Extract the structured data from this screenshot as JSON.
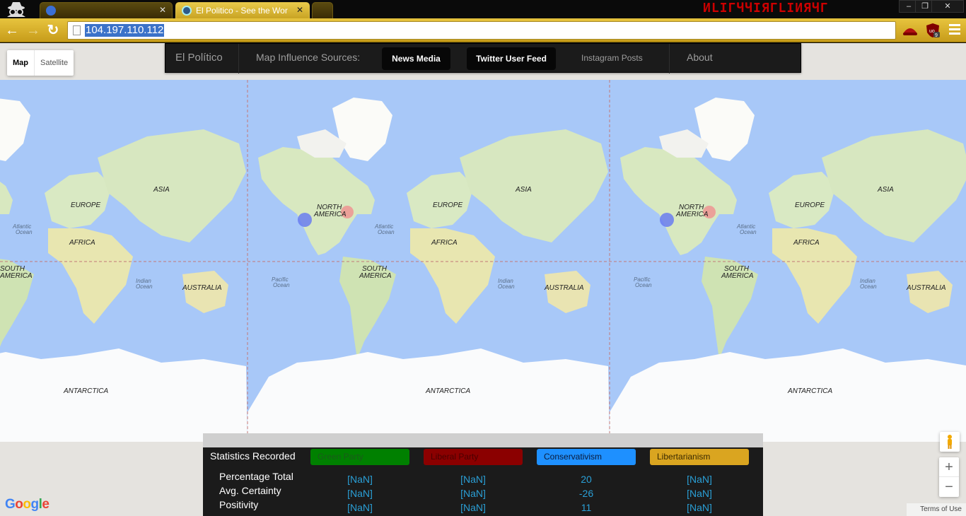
{
  "browser": {
    "tabs": [
      {
        "title": "",
        "active": false
      },
      {
        "title": "El Politico - See the World",
        "active": true
      },
      {
        "title": "",
        "active": false
      }
    ],
    "brand_text": "ИLIГЧЧIЯГLIИЯЧГ",
    "address": "104.197.110.112",
    "window_buttons": [
      "–",
      "❐",
      "✕"
    ]
  },
  "map_type": {
    "map_label": "Map",
    "satellite_label": "Satellite",
    "selected": "Map"
  },
  "navbar": {
    "brand": "El Político",
    "sources_label": "Map Influence Sources:",
    "news_media": "News Media",
    "twitter": "Twitter User Feed",
    "instagram": "Instagram Posts",
    "about": "About"
  },
  "map": {
    "labels": [
      {
        "text": "ASIA"
      },
      {
        "text": "EUROPE"
      },
      {
        "text": "AFRICA"
      },
      {
        "text": "AUSTRALIA"
      },
      {
        "text": "ANTARCTICA"
      },
      {
        "text": "NORTH"
      },
      {
        "text": "AMERICA"
      },
      {
        "text": "SOUTH"
      },
      {
        "text": "Atlantic"
      },
      {
        "text": "Ocean"
      },
      {
        "text": "Indian"
      },
      {
        "text": "Pacific"
      }
    ],
    "markers": {
      "blue_color": "#6a7cf0",
      "red_color": "#f08f8f"
    }
  },
  "footer": {
    "google": "Google",
    "terms": "Terms of Use",
    "zoom_in": "+",
    "zoom_out": "−"
  },
  "stats": {
    "heading": "Statistics Recorded",
    "parties": [
      {
        "name": "Green Party",
        "color": "#008000",
        "text_color": "#1a5a1a"
      },
      {
        "name": "Liberal Party",
        "color": "#8b0000",
        "text_color": "#4a0000"
      },
      {
        "name": "Conservativism",
        "color": "#1e90ff",
        "text_color": "#0b1a3a"
      },
      {
        "name": "Libertarianism",
        "color": "#daa520",
        "text_color": "#3a2a00"
      }
    ],
    "rows": [
      {
        "label": "Percentage Total",
        "values": [
          "[NaN]",
          "[NaN]",
          "20",
          "[NaN]"
        ]
      },
      {
        "label": "Avg. Certainty",
        "values": [
          "[NaN]",
          "[NaN]",
          "-26",
          "[NaN]"
        ]
      },
      {
        "label": "Positivity",
        "values": [
          "[NaN]",
          "[NaN]",
          "11",
          "[NaN]"
        ]
      }
    ]
  }
}
